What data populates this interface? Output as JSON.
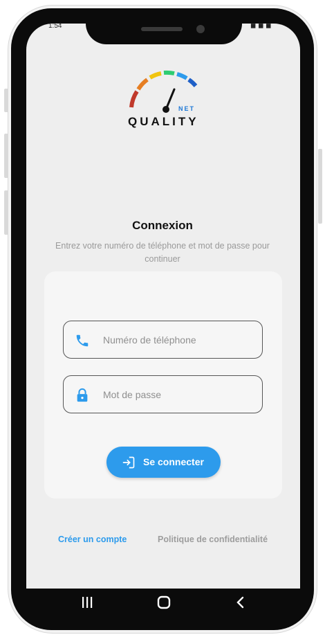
{
  "status_bar": {
    "time": "1:54",
    "indicators": "◼ ◼ ◼"
  },
  "logo": {
    "brand": "QUALITY",
    "suffix": "NET"
  },
  "login": {
    "title": "Connexion",
    "subtitle": "Entrez votre numéro de téléphone et mot de passe pour continuer",
    "phone_placeholder": "Numéro de téléphone",
    "password_placeholder": "Mot de passe",
    "submit_label": "Se connecter"
  },
  "links": {
    "create_account": "Créer un compte",
    "privacy_policy": "Politique de confidentialité"
  },
  "colors": {
    "accent": "#2d9bec",
    "gauge": [
      "#c0392b",
      "#e67e22",
      "#f1c40f",
      "#2ecc71",
      "#2d9bec",
      "#1e5fc7"
    ]
  },
  "icons": {
    "phone_field": "phone-icon",
    "password_field": "lock-icon",
    "submit": "login-icon",
    "nav": [
      "recent-apps-icon",
      "home-icon",
      "back-icon"
    ]
  }
}
